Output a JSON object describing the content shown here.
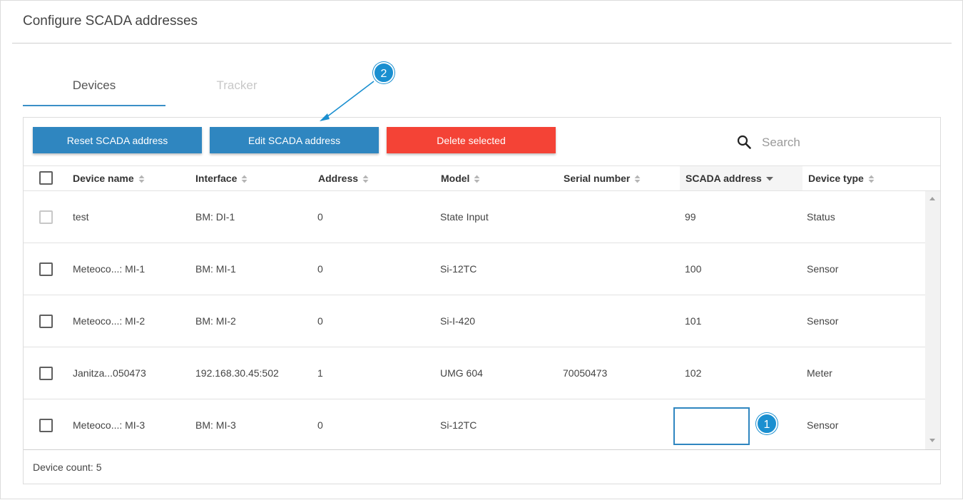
{
  "page": {
    "title": "Configure SCADA addresses"
  },
  "tabs": [
    {
      "label": "Devices",
      "active": true
    },
    {
      "label": "Tracker",
      "active": false
    }
  ],
  "toolbar": {
    "reset_label": "Reset SCADA address",
    "edit_label": "Edit SCADA address",
    "delete_label": "Delete selected",
    "search_placeholder": "Search",
    "search_icon": "search-icon"
  },
  "table": {
    "columns": [
      {
        "label": "Device name",
        "sort": "none"
      },
      {
        "label": "Interface",
        "sort": "none"
      },
      {
        "label": "Address",
        "sort": "none"
      },
      {
        "label": "Model",
        "sort": "none"
      },
      {
        "label": "Serial number",
        "sort": "none"
      },
      {
        "label": "SCADA address",
        "sort": "desc"
      },
      {
        "label": "Device type",
        "sort": "none"
      }
    ],
    "rows": [
      {
        "device_name": "test",
        "interface": "BM: DI-1",
        "address": "0",
        "model": "State Input",
        "serial": "",
        "scada": "99",
        "type": "Status",
        "checkbox_disabled": true
      },
      {
        "device_name": "Meteoco...: MI-1",
        "interface": "BM: MI-1",
        "address": "0",
        "model": "Si-12TC",
        "serial": "",
        "scada": "100",
        "type": "Sensor",
        "checkbox_disabled": false
      },
      {
        "device_name": "Meteoco...: MI-2",
        "interface": "BM: MI-2",
        "address": "0",
        "model": "Si-I-420",
        "serial": "",
        "scada": "101",
        "type": "Sensor",
        "checkbox_disabled": false
      },
      {
        "device_name": "Janitza...050473",
        "interface": "192.168.30.45:502",
        "address": "1",
        "model": "UMG 604",
        "serial": "70050473",
        "scada": "102",
        "type": "Meter",
        "checkbox_disabled": false
      },
      {
        "device_name": "Meteoco...: MI-3",
        "interface": "BM: MI-3",
        "address": "0",
        "model": "Si-12TC",
        "serial": "",
        "scada": "",
        "type": "Sensor",
        "checkbox_disabled": false,
        "editing": true
      }
    ]
  },
  "footer": {
    "device_count": "Device count: 5"
  },
  "callouts": [
    {
      "label": "1"
    },
    {
      "label": "2"
    }
  ],
  "colors": {
    "accent": "#2f86c0",
    "danger": "#f44336",
    "callout": "#1a8fd0"
  }
}
